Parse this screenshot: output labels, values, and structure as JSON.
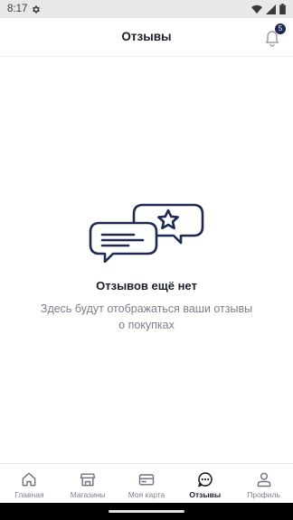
{
  "status_bar": {
    "time": "8:17",
    "icons": [
      "gear-icon",
      "wifi-icon",
      "signal-icon",
      "battery-icon"
    ]
  },
  "header": {
    "title": "Отзывы",
    "notification_count": "5"
  },
  "empty_state": {
    "title": "Отзывов ещё нет",
    "text": "Здесь будут отображаться ваши отзывы о покупках",
    "icon": "reviews-chat-star-icon"
  },
  "tabs": [
    {
      "label": "Главная",
      "icon": "home-icon",
      "active": false
    },
    {
      "label": "Магазины",
      "icon": "store-icon",
      "active": false
    },
    {
      "label": "Моя карта",
      "icon": "card-icon",
      "active": false
    },
    {
      "label": "Отзывы",
      "icon": "chat-bubble-icon",
      "active": true
    },
    {
      "label": "Профиль",
      "icon": "profile-icon",
      "active": false
    }
  ],
  "colors": {
    "primary": "#1e2a52",
    "text": "#1c1f2b",
    "muted": "#7b7f8c",
    "status_bar": "#e8e8e8"
  }
}
